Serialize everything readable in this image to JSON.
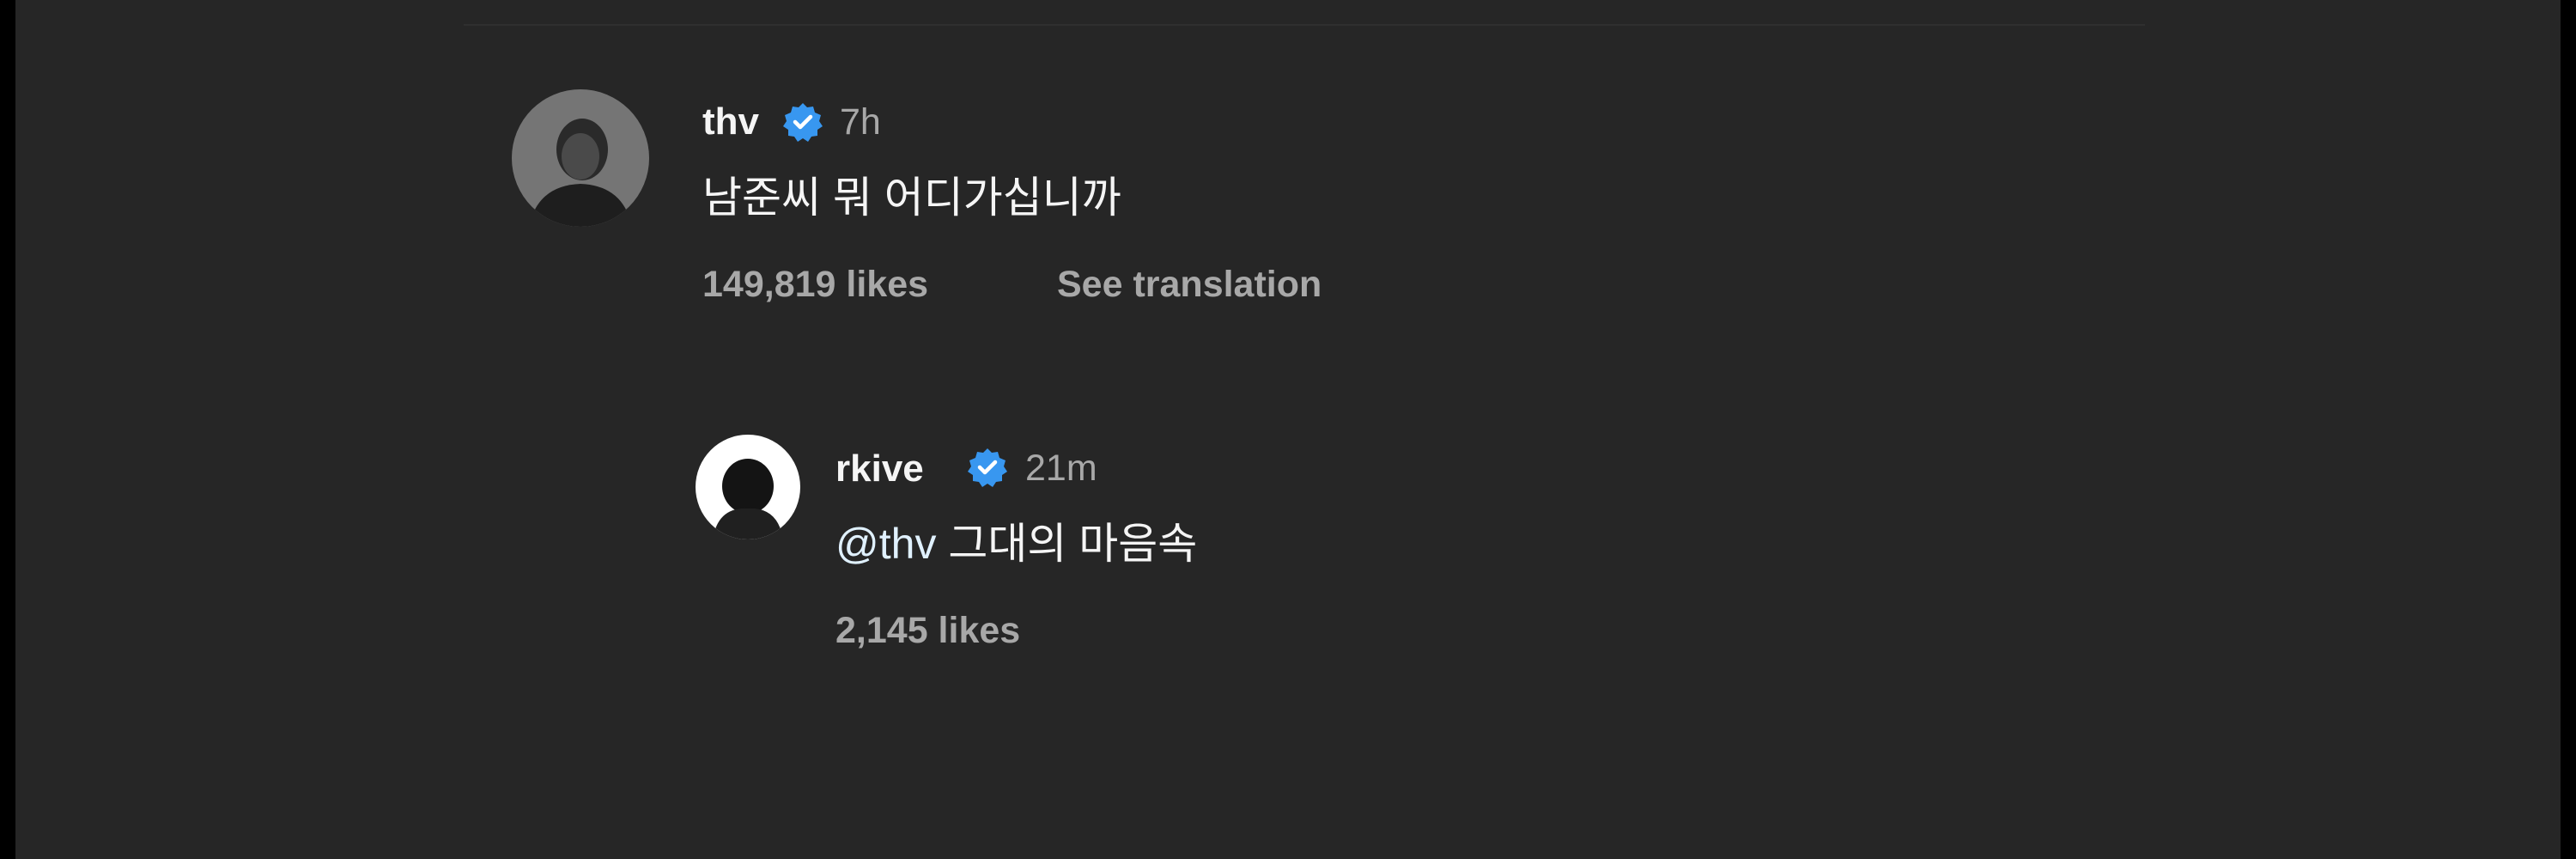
{
  "comments": [
    {
      "username": "thv",
      "verified_icon": "verified-badge-icon",
      "time": "7h",
      "text": "남준씨 뭐 어디가십니까",
      "likes": "149,819 likes",
      "see_translation": "See translation"
    }
  ],
  "reply": {
    "username": "rkive",
    "verified_icon": "verified-badge-icon",
    "time": "21m",
    "mention": "@thv",
    "text": "그대의 마음속",
    "likes": "2,145 likes"
  },
  "colors": {
    "background": "#262626",
    "verified_blue": "#3897f0",
    "primary_text": "#f5f5f5",
    "secondary_text": "#a8a8a8"
  }
}
